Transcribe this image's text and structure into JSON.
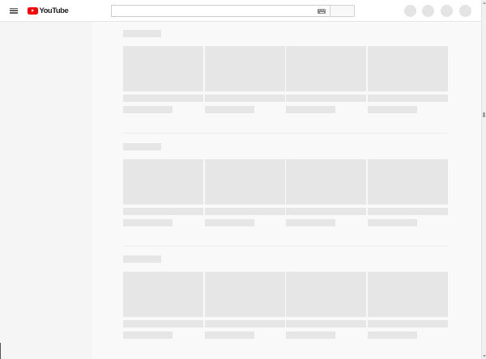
{
  "masthead": {
    "logo_text": "YouTube",
    "brand_color": "#ff0000",
    "menu_icon": "hamburger-menu-icon",
    "keyboard_icon": "keyboard-icon",
    "search_placeholder": "",
    "action_buttons": [
      "apps-icon",
      "messages-icon",
      "notifications-icon",
      "avatar"
    ]
  },
  "loading_state": true,
  "shelves": [
    {
      "placeholder_cards": 4
    },
    {
      "placeholder_cards": 4
    },
    {
      "placeholder_cards": 4
    }
  ]
}
